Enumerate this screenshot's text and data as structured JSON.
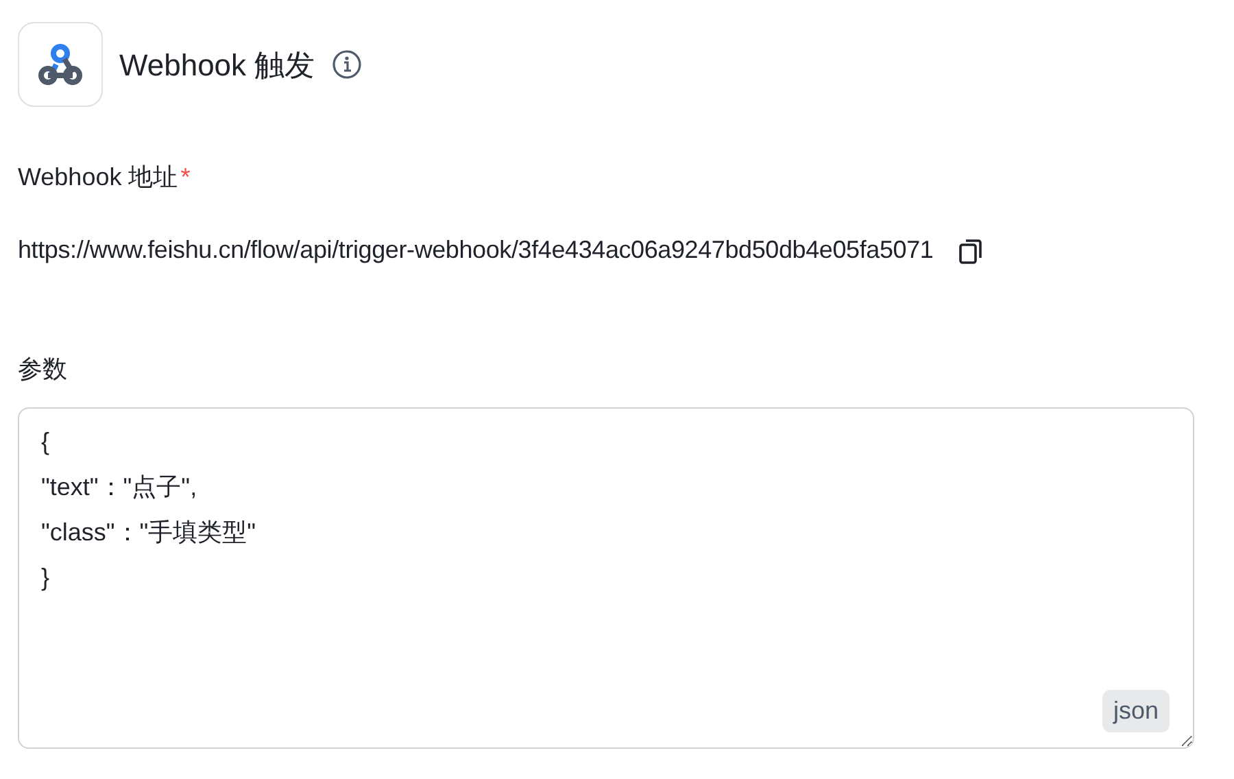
{
  "header": {
    "title": "Webhook 触发"
  },
  "webhook_address": {
    "label": "Webhook 地址",
    "required": true,
    "required_mark": "*",
    "value": "https://www.feishu.cn/flow/api/trigger-webhook/3f4e434ac06a9247bd50db4e05fa5071"
  },
  "params": {
    "label": "参数",
    "value": "{\n\"text\"：\"点子\",\n\"class\"：\"手填类型\"\n}",
    "badge": "json"
  }
}
